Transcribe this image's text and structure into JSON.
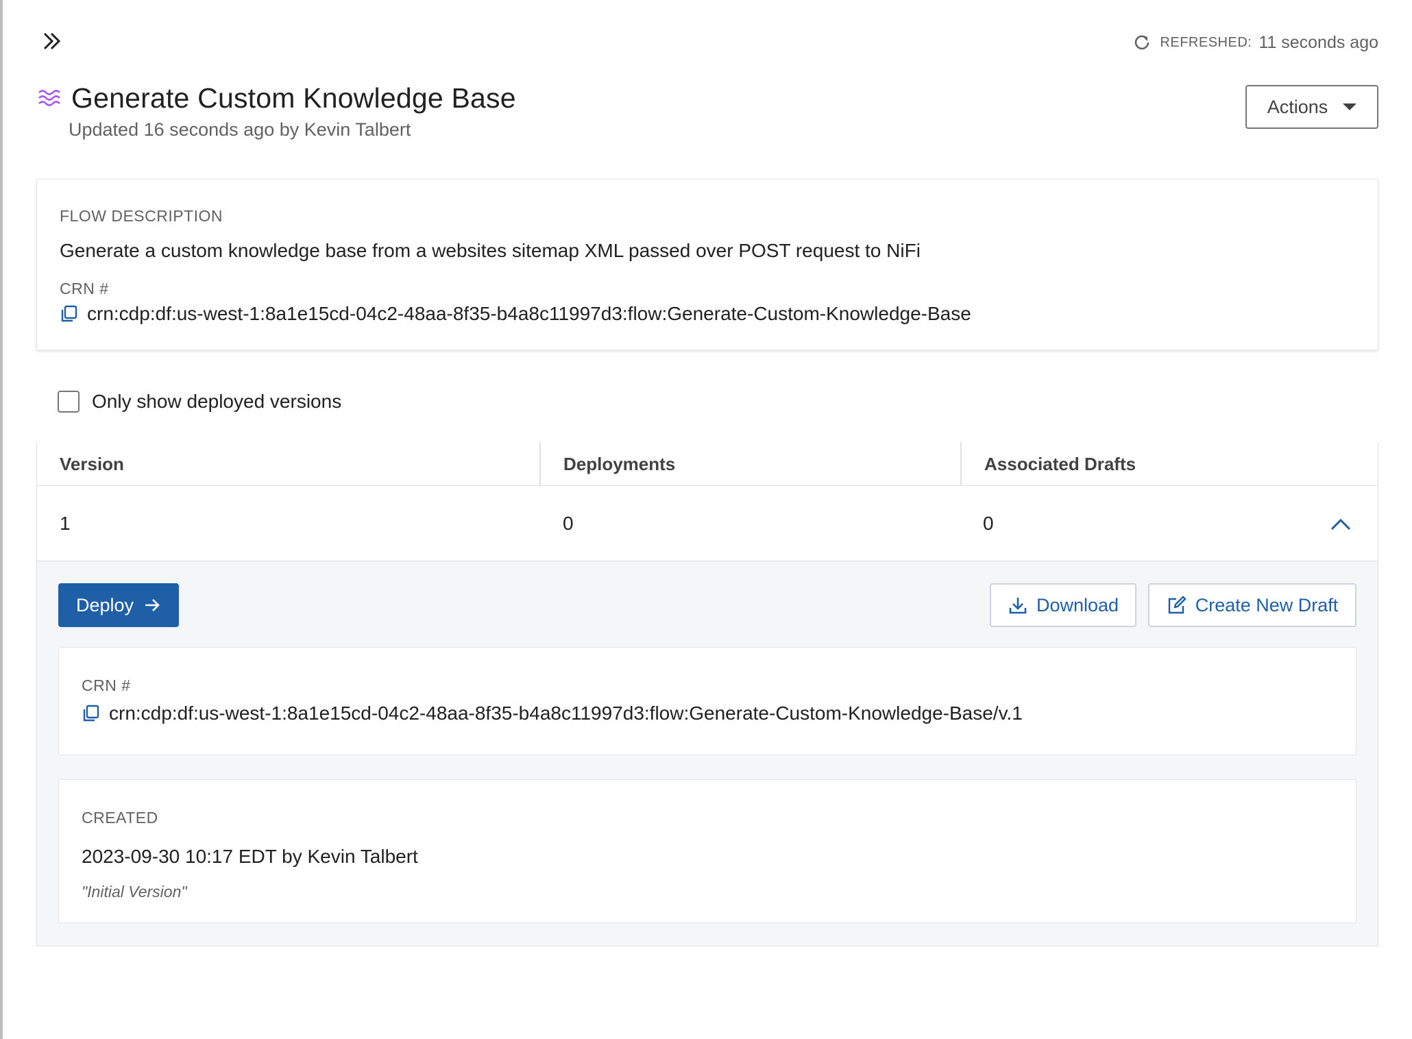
{
  "header": {
    "refresh_label": "REFRESHED:",
    "refresh_value": "11 seconds ago",
    "title": "Generate Custom Knowledge Base",
    "subtitle": "Updated 16 seconds ago by Kevin Talbert",
    "actions_label": "Actions",
    "flow_icon_color": "#a855f7",
    "toggle_icon": "double-chevron-right-icon"
  },
  "description_card": {
    "label": "FLOW DESCRIPTION",
    "text": "Generate a custom knowledge base from a websites sitemap XML passed over POST request to NiFi",
    "crn_label": "CRN #",
    "crn": "crn:cdp:df:us-west-1:8a1e15cd-04c2-48aa-8f35-b4a8c11997d3:flow:Generate-Custom-Knowledge-Base"
  },
  "filter": {
    "label": "Only show deployed versions",
    "checked": false
  },
  "table": {
    "columns": [
      "Version",
      "Deployments",
      "Associated Drafts"
    ],
    "rows": [
      {
        "version": "1",
        "deployments": "0",
        "associated_drafts": "0",
        "expanded": true
      }
    ]
  },
  "expanded_row": {
    "deploy_label": "Deploy",
    "download_label": "Download",
    "create_draft_label": "Create New Draft",
    "crn_label": "CRN #",
    "crn": "crn:cdp:df:us-west-1:8a1e15cd-04c2-48aa-8f35-b4a8c11997d3:flow:Generate-Custom-Knowledge-Base/v.1",
    "created_label": "CREATED",
    "created_text": "2023-09-30 10:17 EDT by Kevin Talbert",
    "created_note": "\"Initial Version\""
  },
  "colors": {
    "primary": "#1f5fa8",
    "accent_purple": "#a855f7",
    "text": "#212121",
    "muted": "#616161"
  }
}
